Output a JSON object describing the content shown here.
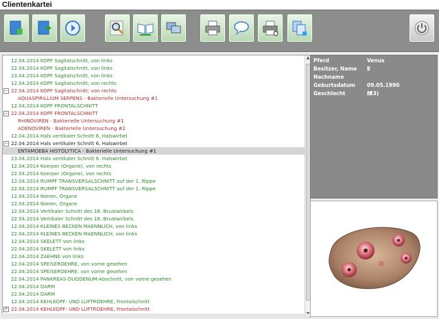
{
  "window": {
    "title": "Clientenkartei"
  },
  "toolbar": {
    "buttons": [
      {
        "icon": "add-document-icon"
      },
      {
        "icon": "export-icon"
      },
      {
        "icon": "play-icon"
      },
      {
        "icon": "magnifier-icon"
      },
      {
        "icon": "open-book-icon"
      },
      {
        "icon": "monitors-icon"
      },
      {
        "icon": "printer-icon"
      },
      {
        "icon": "speech-bubble-icon"
      },
      {
        "icon": "print-preview-icon"
      },
      {
        "icon": "copy-pages-icon"
      },
      {
        "icon": "power-icon"
      }
    ]
  },
  "colors": {
    "green": "#2e8b2e",
    "red": "#b03030",
    "dark": "#222222"
  },
  "tree": {
    "rows": [
      {
        "text": "12.04.2014  KOPF Sagitalschnitt, von links",
        "color": "green",
        "indent": 1,
        "expander": ""
      },
      {
        "text": "22.04.2014  KOPF Sagitalschnitt, von links",
        "color": "green",
        "indent": 1,
        "expander": ""
      },
      {
        "text": "23.04.2014  KOPF Sagitalschnitt, von links",
        "color": "green",
        "indent": 1,
        "expander": ""
      },
      {
        "text": "12.04.2014  KOPF Sagitalschnitt; von rechts",
        "color": "green",
        "indent": 1,
        "expander": ""
      },
      {
        "text": "22.04.2014  KOPF Sagitalschnitt; von rechts",
        "color": "red",
        "indent": 1,
        "expander": "−"
      },
      {
        "text": "AQUASPIRILLIUM  SERPENS - Bakterielle Untersuchung #1",
        "color": "red",
        "indent": 2,
        "expander": ""
      },
      {
        "text": "12.04.2014  KOPF FRONTALSCHNITT",
        "color": "green",
        "indent": 1,
        "expander": ""
      },
      {
        "text": "22.04.2014  KOPF FRONTALSCHNITT",
        "color": "red",
        "indent": 1,
        "expander": "−"
      },
      {
        "text": "RHINOVIREN - Bakterielle Untersuchung #1",
        "color": "red",
        "indent": 2,
        "expander": ""
      },
      {
        "text": "ADENOVIREN - Bakterielle Untersuchung #2",
        "color": "red",
        "indent": 2,
        "expander": ""
      },
      {
        "text": "12.04.2014  Hals vertikaler Schnitt 6. Halswirbel",
        "color": "green",
        "indent": 1,
        "expander": ""
      },
      {
        "text": "22.04.2014  Hals vertikaler Schnitt 6. Halswirbel",
        "color": "dark",
        "indent": 1,
        "expander": "−"
      },
      {
        "text": "ENTAMOEBA  HISTOLYTICA - Bakterielle Untersuchung #1",
        "color": "dark",
        "indent": 2,
        "expander": "",
        "selected": true
      },
      {
        "text": "23.04.2014  Hals vertikaler Schnitt 6. Halswirbel",
        "color": "green",
        "indent": 1,
        "expander": ""
      },
      {
        "text": "12.04.2014  Koerper (Organe), von rechts",
        "color": "green",
        "indent": 1,
        "expander": ""
      },
      {
        "text": "22.04.2014  Koerper (Organe), von rechts",
        "color": "green",
        "indent": 1,
        "expander": ""
      },
      {
        "text": "12.04.2014  RUMPF TRANSVERSALSCHNITT auf der 1. Rippe",
        "color": "green",
        "indent": 1,
        "expander": ""
      },
      {
        "text": "22.04.2014  RUMPF TRANSVERSALSCHNITT auf der 1. Rippe",
        "color": "green",
        "indent": 1,
        "expander": ""
      },
      {
        "text": "12.04.2014  Nieren, Organe",
        "color": "green",
        "indent": 1,
        "expander": ""
      },
      {
        "text": "22.04.2014  Nieren, Organe",
        "color": "green",
        "indent": 1,
        "expander": ""
      },
      {
        "text": "12.04.2014  Vertikaler Schnitt des 16. Brustwirbels",
        "color": "green",
        "indent": 1,
        "expander": ""
      },
      {
        "text": "22.04.2014  Vertikaler Schnitt des 16. Brustwirbels",
        "color": "green",
        "indent": 1,
        "expander": ""
      },
      {
        "text": "12.04.2014  KLEINES BECKEN MAENNLICH, von links",
        "color": "green",
        "indent": 1,
        "expander": ""
      },
      {
        "text": "22.04.2014  KLEINES BECKEN MAENNLICH, von links",
        "color": "green",
        "indent": 1,
        "expander": ""
      },
      {
        "text": "12.04.2014  SKELETT von links",
        "color": "green",
        "indent": 1,
        "expander": ""
      },
      {
        "text": "22.04.2014  SKELETT von links",
        "color": "green",
        "indent": 1,
        "expander": ""
      },
      {
        "text": "22.04.2014  ZAEHNE von links",
        "color": "green",
        "indent": 1,
        "expander": ""
      },
      {
        "text": "12.04.2014  SPEISEROEHRE, von vorne gesehen",
        "color": "green",
        "indent": 1,
        "expander": ""
      },
      {
        "text": "22.04.2014  SPEISEROEHRE, von vorne gesehen",
        "color": "green",
        "indent": 1,
        "expander": ""
      },
      {
        "text": "22.04.2014  PANKREAS-DUODENUM-Abschnitt, von vorne gesehen",
        "color": "green",
        "indent": 1,
        "expander": ""
      },
      {
        "text": "12.04.2014  DARM",
        "color": "green",
        "indent": 1,
        "expander": ""
      },
      {
        "text": "22.04.2014  DARM",
        "color": "green",
        "indent": 1,
        "expander": ""
      },
      {
        "text": "12.04.2014  KEHLKOPF- UND LUFTROEHRE, Frontalschnitt",
        "color": "green",
        "indent": 1,
        "expander": ""
      },
      {
        "text": "22.04.2014  KEHLKOPF- UND LUFTROEHRE, Frontalschnitt",
        "color": "red",
        "indent": 1,
        "expander": "+"
      }
    ]
  },
  "info": {
    "rows": [
      {
        "label": "Pferd",
        "value": "Venus 2"
      },
      {
        "label": "Besitzer, Name",
        "value": "l"
      },
      {
        "label": "Nachname",
        "value": ""
      },
      {
        "label": "Geburtsdatum",
        "value": "09.05.1990 (23)"
      },
      {
        "label": "Geschlecht",
        "value": "M"
      }
    ]
  }
}
